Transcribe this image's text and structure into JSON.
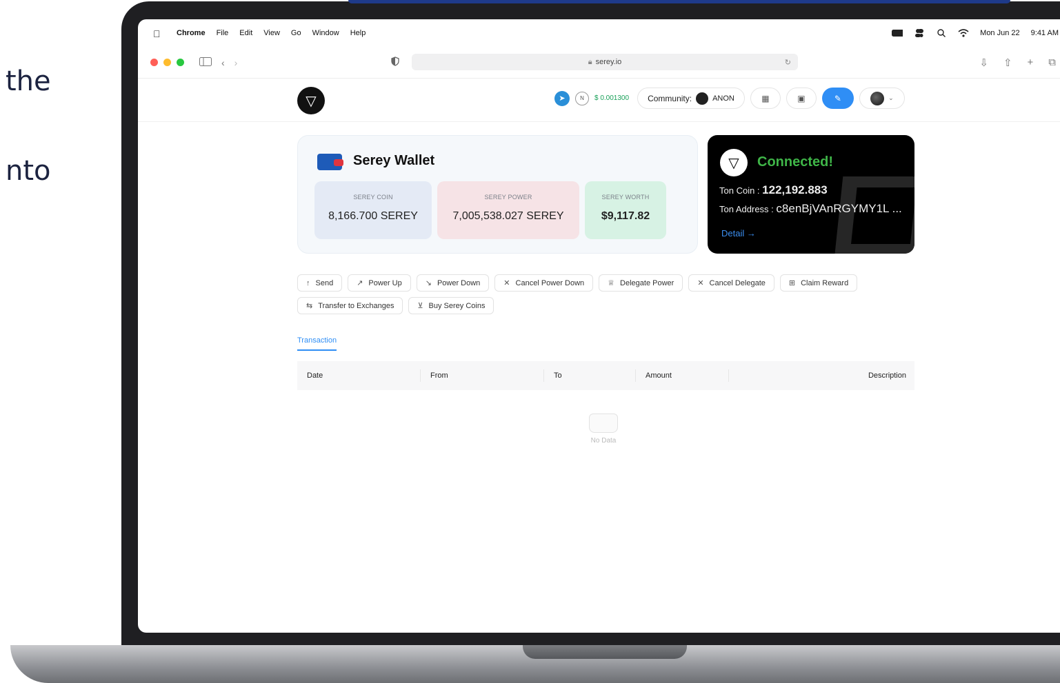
{
  "side_text": {
    "line1": "the",
    "line2": "nto"
  },
  "menubar": {
    "app": "Chrome",
    "menus": [
      "File",
      "Edit",
      "View",
      "Go",
      "Window",
      "Help"
    ],
    "date": "Mon Jun 22",
    "time": "9:41 AM"
  },
  "browser": {
    "url": "serey.io"
  },
  "header": {
    "price": "$ 0.001300",
    "community_label": "Community:",
    "community_value": "ANON"
  },
  "wallet": {
    "title": "Serey Wallet",
    "stats": [
      {
        "label": "SEREY COIN",
        "value": "8,166.700 SEREY"
      },
      {
        "label": "SEREY POWER",
        "value": "7,005,538.027 SEREY"
      },
      {
        "label": "SEREY WORTH",
        "value": "$9,117.82"
      }
    ]
  },
  "connected": {
    "title": "Connected!",
    "coin_label": "Ton Coin :",
    "coin_value": "122,192.883",
    "address_label": "Ton Address :",
    "address_value": "c8enBjVAnRGYMY1L ...",
    "detail": "Detail"
  },
  "actions": [
    {
      "label": "Send",
      "icon": "arrow-up-icon",
      "glyph": "↑"
    },
    {
      "label": "Power Up",
      "icon": "trend-up-icon",
      "glyph": "↗"
    },
    {
      "label": "Power Down",
      "icon": "trend-down-icon",
      "glyph": "↘"
    },
    {
      "label": "Cancel Power Down",
      "icon": "close-icon",
      "glyph": "✕"
    },
    {
      "label": "Delegate Power",
      "icon": "trophy-icon",
      "glyph": "♕"
    },
    {
      "label": "Cancel Delegate",
      "icon": "close-icon",
      "glyph": "✕"
    },
    {
      "label": "Claim Reward",
      "icon": "gift-icon",
      "glyph": "⊞"
    },
    {
      "label": "Transfer to Exchanges",
      "icon": "swap-icon",
      "glyph": "⇆"
    },
    {
      "label": "Buy Serey Coins",
      "icon": "cart-icon",
      "glyph": "⊻"
    }
  ],
  "tabs": {
    "active": "Transaction"
  },
  "table": {
    "columns": [
      "Date",
      "From",
      "To",
      "Amount",
      "Description"
    ],
    "empty_text": "No Data"
  },
  "colors": {
    "accent": "#2f8ef5",
    "connected_green": "#3fb548",
    "coin_bg": "#e4eaf5",
    "power_bg": "#f6e3e6",
    "worth_bg": "#d7f2e4"
  }
}
